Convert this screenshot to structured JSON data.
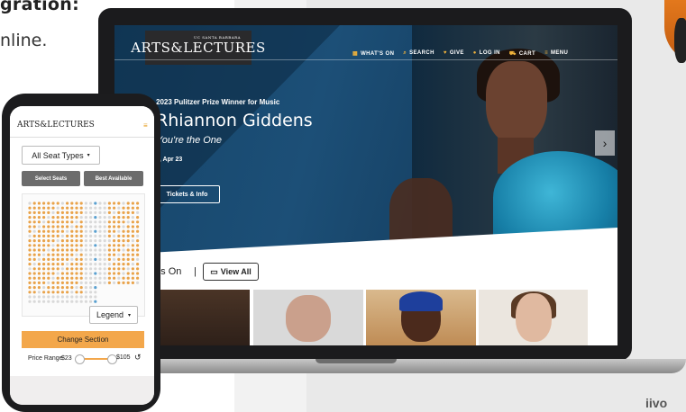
{
  "page": {
    "headline": "gration:",
    "subline": "nline.",
    "corner_text": "iivo"
  },
  "site": {
    "logo": "ARTS&LECTURES",
    "logo_small": "UC SANTA BARBARA",
    "nav": [
      {
        "icon": "calendar-icon",
        "glyph": "▦",
        "label": "WHAT'S ON"
      },
      {
        "icon": "search-icon",
        "glyph": "⌕",
        "label": "SEARCH"
      },
      {
        "icon": "heart-icon",
        "glyph": "♥",
        "label": "GIVE"
      },
      {
        "icon": "user-icon",
        "glyph": "●",
        "label": "LOG IN"
      },
      {
        "icon": "cart-icon",
        "glyph": "⛟",
        "label": "CART"
      },
      {
        "icon": "menu-icon",
        "glyph": "≡",
        "label": "MENU"
      }
    ]
  },
  "hero": {
    "kicker": "2023 Pulitzer Prize Winner for Music",
    "title": "Rhiannon Giddens",
    "subtitle": "You're the One",
    "date": "e, Apr 23",
    "button": "Tickets & Info",
    "next_glyph": "›"
  },
  "whats_on": {
    "heading": "t's On",
    "divider": "|",
    "view_all": "View All",
    "view_all_icon": "▭"
  },
  "phone": {
    "logo": "ARTS&LECTURES",
    "menu_glyph": "≡",
    "seat_types": "All Seat Types",
    "tab_select": "Select Seats",
    "tab_best": "Best Available",
    "legend": "Legend",
    "change_section": "Change Section",
    "price_label": "Price Range",
    "price_min": "$23",
    "price_max": "$105",
    "reset_glyph": "↺",
    "seat_colors": {
      "available": "#e9a34a",
      "unavailable": "#d9d9d9"
    }
  },
  "colors": {
    "accent": "#f0b23b",
    "hero_bg": "#123a5a",
    "button_orange": "#f3a74b"
  }
}
